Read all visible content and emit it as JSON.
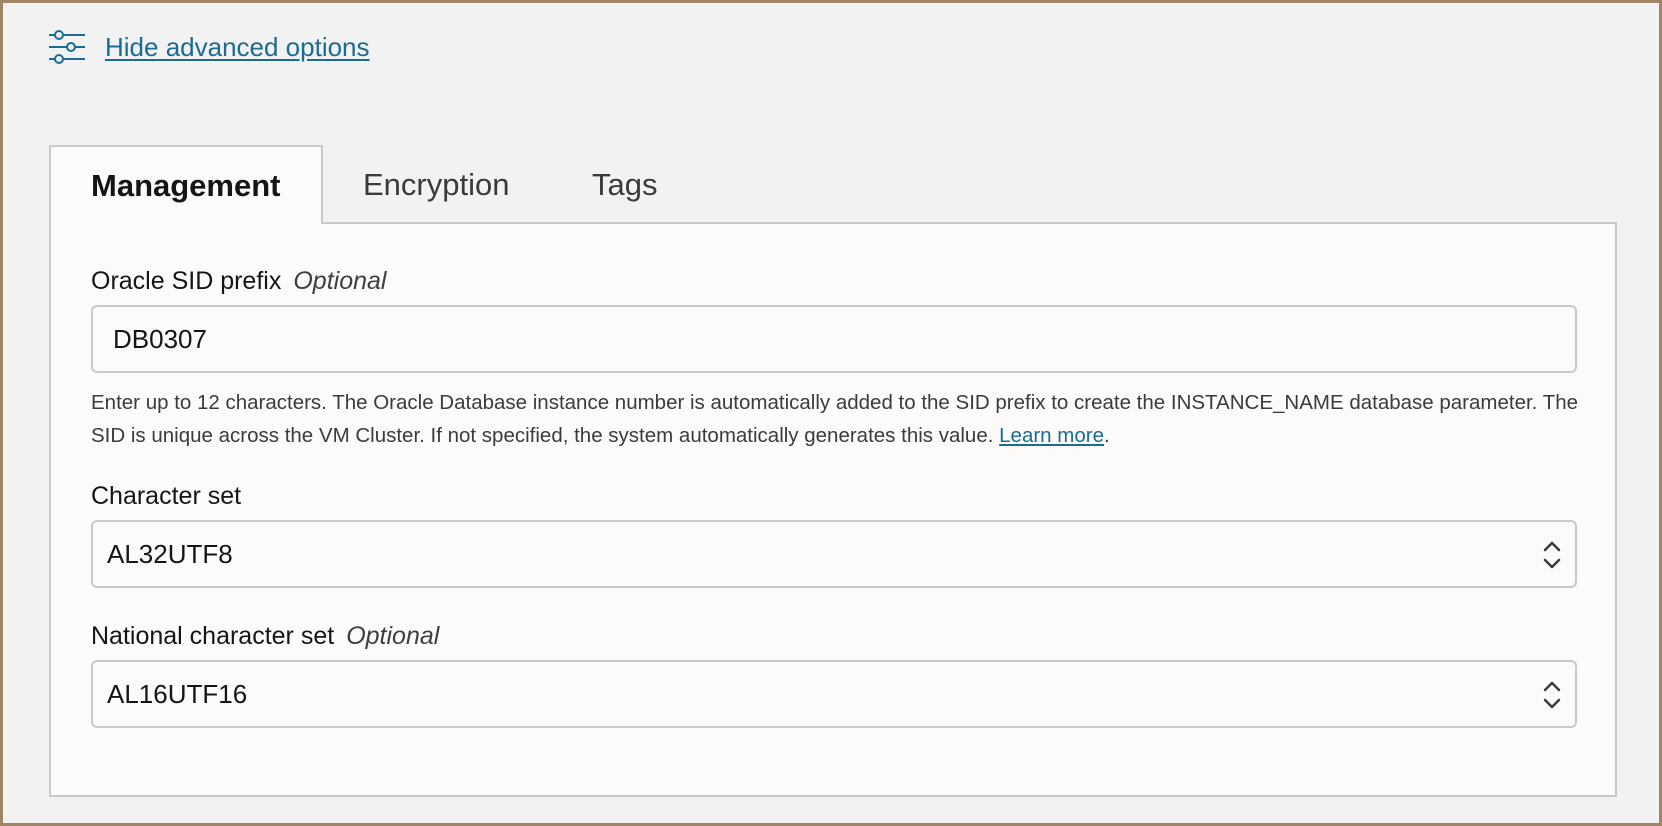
{
  "advanced_toggle": {
    "label": "Hide advanced options",
    "icon": "sliders-icon"
  },
  "tabs": [
    {
      "label": "Management",
      "active": true
    },
    {
      "label": "Encryption",
      "active": false
    },
    {
      "label": "Tags",
      "active": false
    }
  ],
  "form": {
    "sid_prefix": {
      "label": "Oracle SID prefix",
      "optional": "Optional",
      "value": "DB0307",
      "help_text": "Enter up to 12 characters. The Oracle Database instance number is automatically added to the SID prefix to create the INSTANCE_NAME database parameter. The SID is unique across the VM Cluster. If not specified, the system automatically generates this value.",
      "learn_more": "Learn more",
      "trailing": "."
    },
    "character_set": {
      "label": "Character set",
      "value": "AL32UTF8"
    },
    "national_character_set": {
      "label": "National character set",
      "optional": "Optional",
      "value": "AL16UTF16"
    }
  },
  "colors": {
    "frame_border": "#a08566",
    "link": "#1b6c93",
    "background": "#f3f2f2",
    "panel": "#fcfbfa"
  }
}
